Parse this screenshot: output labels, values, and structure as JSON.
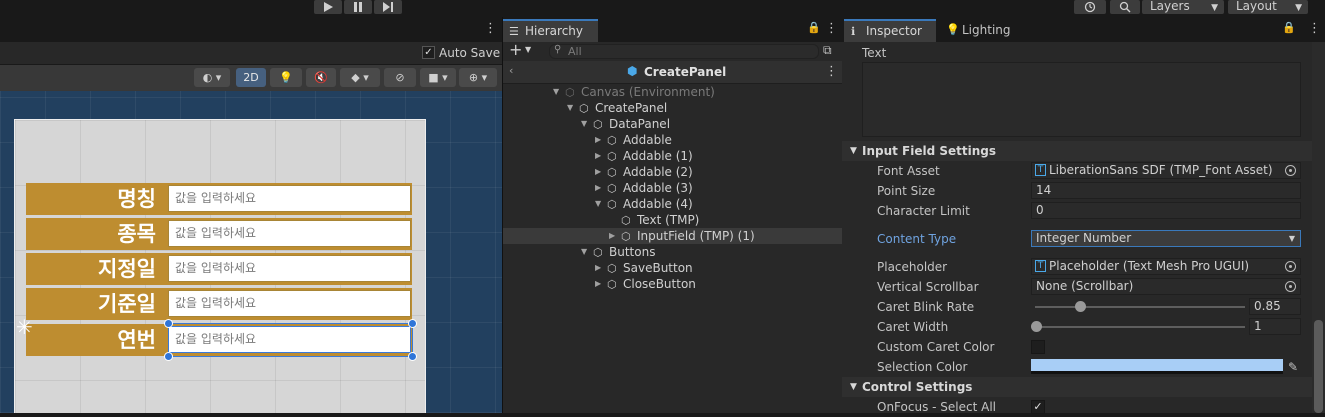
{
  "topbar": {
    "play_icon": "play-icon",
    "pause_icon": "pause-icon",
    "step_icon": "step-icon",
    "history_icon": "history-icon",
    "search_icon": "search-icon",
    "layers_label": "Layers",
    "layout_label": "Layout"
  },
  "scene": {
    "autosave_label": "Auto Save",
    "autosave_checked": true,
    "toolbar_2d_label": "2D",
    "canvas_rows": [
      {
        "label": "명칭",
        "placeholder": "값을 입력하세요"
      },
      {
        "label": "종목",
        "placeholder": "값을 입력하세요"
      },
      {
        "label": "지정일",
        "placeholder": "값을 입력하세요"
      },
      {
        "label": "기준일",
        "placeholder": "값을 입력하세요"
      },
      {
        "label": "연번",
        "placeholder": "값을 입력하세요"
      }
    ]
  },
  "hierarchy": {
    "tab_label": "Hierarchy",
    "search_placeholder": "All",
    "header_title": "CreatePanel",
    "items": [
      {
        "label": "Canvas (Environment)"
      },
      {
        "label": "CreatePanel"
      },
      {
        "label": "DataPanel"
      },
      {
        "label": "Addable"
      },
      {
        "label": "Addable (1)"
      },
      {
        "label": "Addable (2)"
      },
      {
        "label": "Addable (3)"
      },
      {
        "label": "Addable (4)"
      },
      {
        "label": "Text (TMP)"
      },
      {
        "label": "InputField (TMP) (1)"
      },
      {
        "label": "Buttons"
      },
      {
        "label": "SaveButton"
      },
      {
        "label": "CloseButton"
      }
    ]
  },
  "inspector": {
    "tab_inspector": "Inspector",
    "tab_lighting": "Lighting",
    "text_label": "Text",
    "input_field_settings": "Input Field Settings",
    "font_asset_label": "Font Asset",
    "font_asset_value": "LiberationSans SDF (TMP_Font Asset)",
    "point_size_label": "Point Size",
    "point_size_value": "14",
    "character_limit_label": "Character Limit",
    "character_limit_value": "0",
    "content_type_label": "Content Type",
    "content_type_value": "Integer Number",
    "placeholder_label": "Placeholder",
    "placeholder_value": "Placeholder (Text Mesh Pro UGUI)",
    "vertical_scrollbar_label": "Vertical Scrollbar",
    "vertical_scrollbar_value": "None (Scrollbar)",
    "caret_blink_rate_label": "Caret Blink Rate",
    "caret_blink_rate_value": "0.85",
    "caret_width_label": "Caret Width",
    "caret_width_value": "1",
    "custom_caret_color_label": "Custom Caret Color",
    "custom_caret_color_checked": false,
    "selection_color_label": "Selection Color",
    "selection_color_value": "#a8cef6",
    "control_settings": "Control Settings",
    "onfocus_select_all_label": "OnFocus - Select All",
    "onfocus_select_all_checked": true
  },
  "colors": {
    "accent_blue": "#3a79bb",
    "row_gold": "#be8d30",
    "scene_bg": "#22405f",
    "content_type_label_color": "#6fa3e0"
  }
}
